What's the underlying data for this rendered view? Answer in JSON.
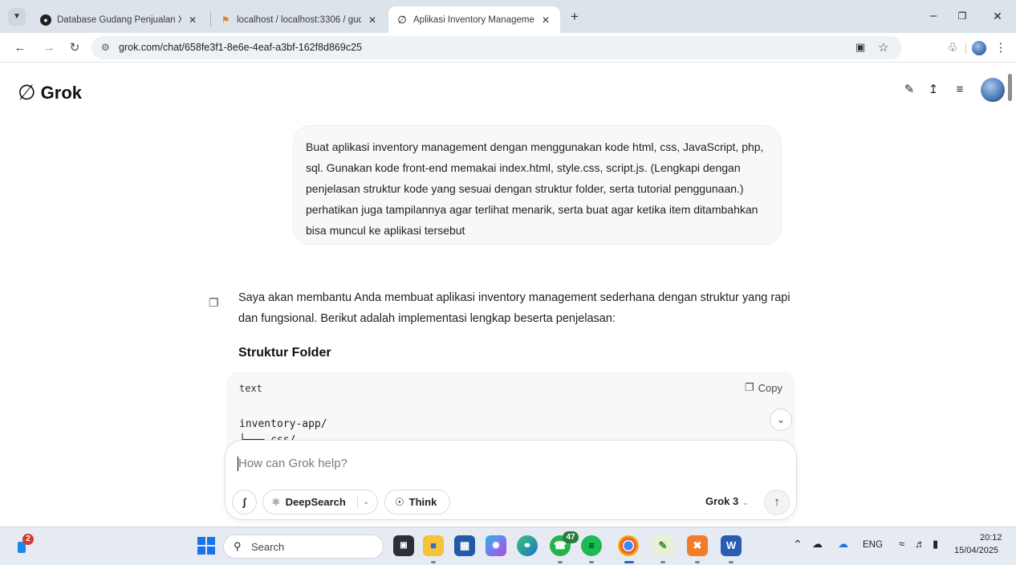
{
  "browser": {
    "tabs": [
      {
        "title": "Database Gudang Penjualan XA",
        "favicon": "globe-icon"
      },
      {
        "title": "localhost / localhost:3306 / gud",
        "favicon": "phpmyadmin-icon"
      },
      {
        "title": "Aplikasi Inventory Managemen",
        "favicon": "grok-icon"
      }
    ],
    "new_tab": "+",
    "url": "grok.com/chat/658fe3f1-8e6e-4eaf-a3bf-162f8d869c25"
  },
  "app": {
    "brand": "Grok"
  },
  "chat": {
    "user_message": "Buat aplikasi inventory management dengan menggunakan kode html, css, JavaScript, php, sql. Gunakan kode front-end memakai index.html, style.css, script.js. (Lengkapi dengan penjelasan struktur kode yang sesuai dengan struktur folder, serta tutorial penggunaan.) perhatikan juga tampilannya agar terlihat menarik, serta buat agar ketika item ditambahkan bisa muncul ke aplikasi tersebut",
    "assistant_intro": "Saya akan membantu Anda membuat aplikasi inventory management sederhana dengan struktur yang rapi dan fungsional. Berikut adalah implementasi lengkap beserta penjelasan:",
    "heading": "Struktur Folder",
    "code": {
      "language": "text",
      "copy_label": "Copy",
      "line1": "inventory-app/",
      "line2": "└─── css/"
    }
  },
  "composer": {
    "placeholder": "How can Grok help?",
    "deepsearch_label": "DeepSearch",
    "think_label": "Think",
    "model_label": "Grok 3"
  },
  "taskbar": {
    "search_label": "Search",
    "notification_count": "2",
    "whatsapp_badge": "47",
    "language": "ENG",
    "time": "20:12",
    "date": "15/04/2025"
  }
}
